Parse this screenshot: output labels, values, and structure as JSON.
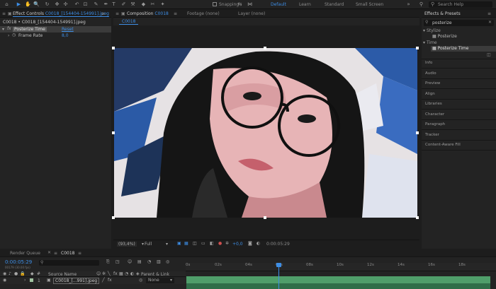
{
  "workspaces": [
    "Default",
    "Learn",
    "Standard",
    "Small Screen"
  ],
  "search_help": {
    "placeholder": "Search Help"
  },
  "snapping": "Snapping",
  "effect_controls": {
    "tab": "Effect Controls",
    "layer_name": "C0018_[154404-154991].jpeg",
    "breadcrumb": "C0018 • C0018_[154404-154991].jpeg",
    "effect_name": "Posterize Time",
    "reset": "Reset",
    "param_label": "Frame Rate",
    "param_value": "8,0"
  },
  "composition": {
    "tab": "Composition",
    "comp_name": "C0018",
    "footage_tab": "Footage (none)",
    "layer_tab": "Layer (none)",
    "flow_label": "C0018",
    "zoom": "(93,4%)",
    "resolution": "Full",
    "exposure": "+0,0",
    "timecode": "0:00:05:29"
  },
  "effects_presets": {
    "title": "Effects & Presets",
    "search_value": "posterize",
    "groups": [
      {
        "category": "Stylize",
        "item": "Posterize"
      },
      {
        "category": "Time",
        "item": "Posterize Time"
      }
    ],
    "panels": [
      "Info",
      "Audio",
      "Preview",
      "Align",
      "Libraries",
      "Character",
      "Paragraph",
      "Tracker",
      "Content-Aware Fill"
    ]
  },
  "timeline": {
    "tabs": [
      "Render Queue",
      "C0018"
    ],
    "current_time": "0:00:05:29",
    "frame_sub": "00179 (30.00 fps)",
    "source_name_header": "Source Name",
    "parent_header": "Parent & Link",
    "layer_index": "1",
    "layer_name": "C0018_[...991].jpeg",
    "parent_value": "None",
    "ruler": [
      "0s",
      "02s",
      "04s",
      "06s",
      "08s",
      "10s",
      "12s",
      "14s",
      "16s",
      "18s"
    ]
  },
  "colors": {
    "accent": "#3d8ee6",
    "work_area": "#4f9e6a",
    "panel_bg": "#232323"
  }
}
